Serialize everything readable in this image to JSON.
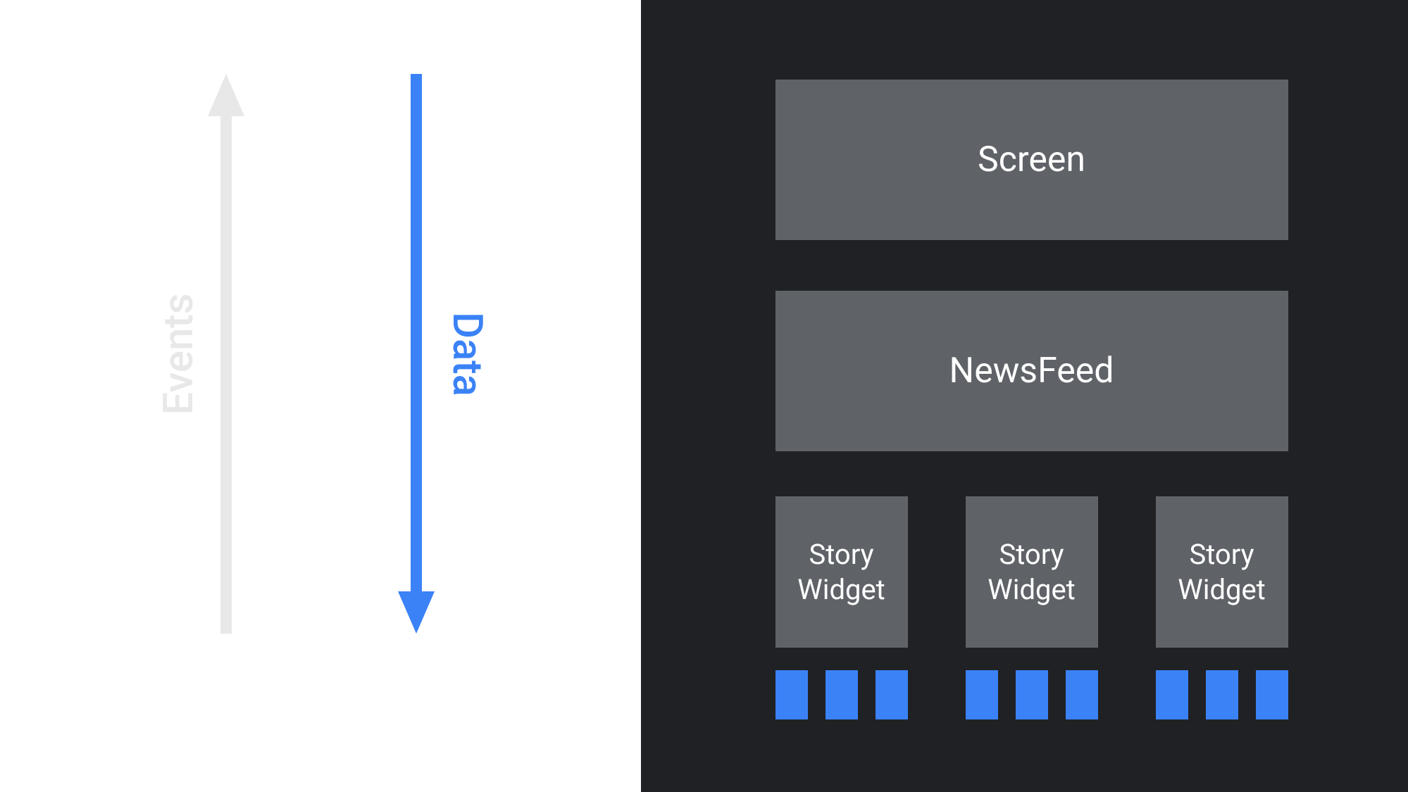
{
  "arrows": {
    "events": {
      "label": "Events",
      "direction": "up",
      "color": "#e8e8e8"
    },
    "data": {
      "label": "Data",
      "direction": "down",
      "color": "#3b82f6"
    }
  },
  "hierarchy": {
    "screen": {
      "label": "Screen"
    },
    "newsfeed": {
      "label": "NewsFeed"
    },
    "storyWidgets": [
      {
        "label": "Story\nWidget",
        "children": 3
      },
      {
        "label": "Story\nWidget",
        "children": 3
      },
      {
        "label": "Story\nWidget",
        "children": 3
      }
    ]
  },
  "colors": {
    "accent": "#3b82f6",
    "muted": "#e8e8e8",
    "block": "#5f6368",
    "dark": "#202124"
  }
}
